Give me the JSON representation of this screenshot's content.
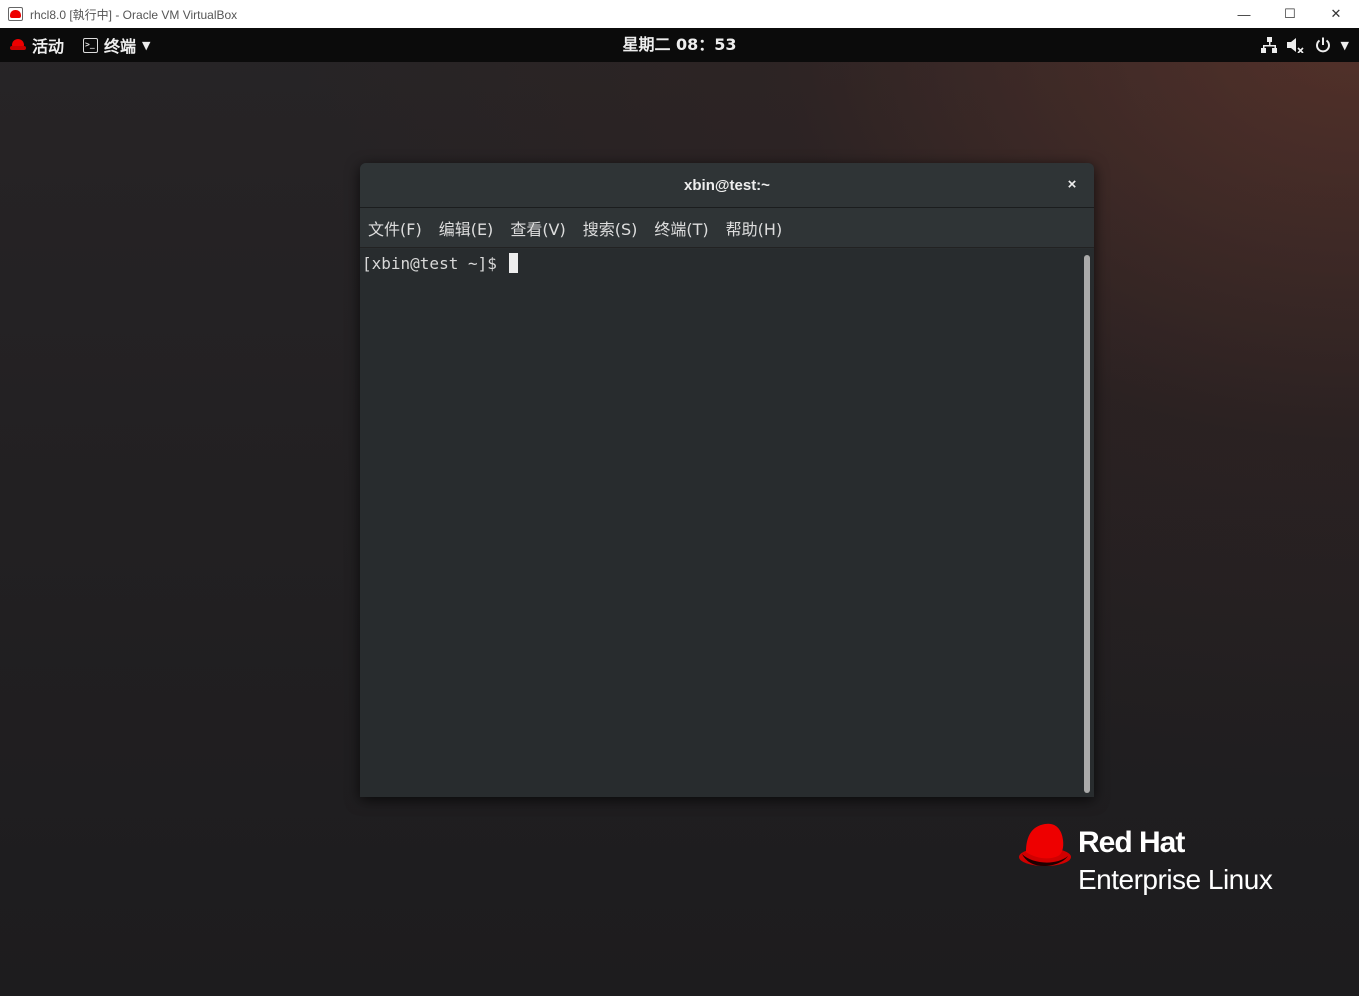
{
  "host": {
    "window_title": "rhcl8.0 [執行中] - Oracle VM VirtualBox",
    "minimize_glyph": "—",
    "maximize_glyph": "☐",
    "close_glyph": "✕"
  },
  "topbar": {
    "activities_label": "活动",
    "app_menu_label": "终端",
    "clock": "星期二 08：53",
    "status_icons": [
      "network-icon",
      "volume-icon",
      "power-icon"
    ]
  },
  "terminal": {
    "title": "xbin@test:~",
    "close_glyph": "×",
    "menu": [
      "文件(F)",
      "编辑(E)",
      "查看(V)",
      "搜索(S)",
      "终端(T)",
      "帮助(H)"
    ],
    "prompt": "[xbin@test ~]$ "
  },
  "branding": {
    "line1": "Red Hat",
    "line2": "Enterprise Linux"
  },
  "colors": {
    "redhat_red": "#ee0000",
    "topbar_bg": "#0b0b0b",
    "terminal_bg": "#282c2e"
  }
}
